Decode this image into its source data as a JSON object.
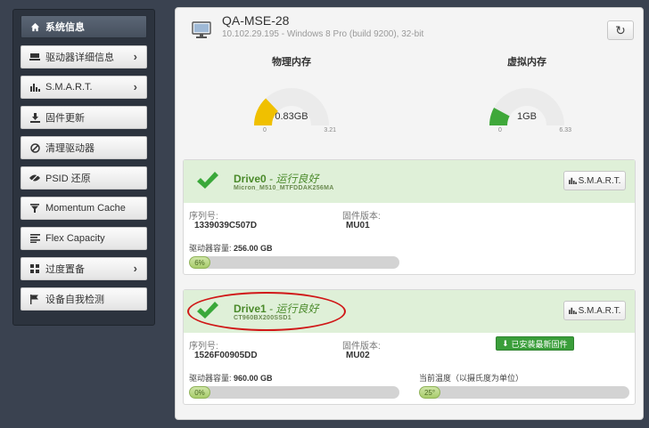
{
  "sidebar": {
    "items": [
      {
        "label": "系统信息",
        "icon": "home-icon",
        "active": true,
        "chevron": false
      },
      {
        "label": "驱动器详细信息",
        "icon": "drive-icon",
        "active": false,
        "chevron": true
      },
      {
        "label": "S.M.A.R.T.",
        "icon": "bar-chart-icon",
        "active": false,
        "chevron": true
      },
      {
        "label": "固件更新",
        "icon": "download-icon",
        "active": false,
        "chevron": false
      },
      {
        "label": "清理驱动器",
        "icon": "no-entry-icon",
        "active": false,
        "chevron": false
      },
      {
        "label": "PSID 还原",
        "icon": "psid-icon",
        "active": false,
        "chevron": false
      },
      {
        "label": "Momentum Cache",
        "icon": "filter-icon",
        "active": false,
        "chevron": false
      },
      {
        "label": "Flex Capacity",
        "icon": "list-icon",
        "active": false,
        "chevron": false
      },
      {
        "label": "过度置备",
        "icon": "grid-icon",
        "active": false,
        "chevron": true
      },
      {
        "label": "设备自我检测",
        "icon": "flag-icon",
        "active": false,
        "chevron": false
      }
    ],
    "chevron_glyph": "›"
  },
  "host": {
    "name": "QA-MSE-28",
    "subtitle": "10.102.29.195 - Windows 8 Pro (build 9200), 32-bit",
    "icon": "monitor-icon",
    "refresh_glyph": "↻"
  },
  "gauges": {
    "physical": {
      "title": "物理内存",
      "value_label": "0.83GB",
      "min_label": "0",
      "max_label": "3.21",
      "used": 0.83,
      "max": 3.21,
      "color": "#f0c000"
    },
    "virtual": {
      "title": "虚拟内存",
      "value_label": "1GB",
      "min_label": "0",
      "max_label": "6.33",
      "used": 1,
      "max": 6.33,
      "color": "#3fa83a"
    }
  },
  "drives": [
    {
      "name": "Drive0",
      "status": " - 运行良好",
      "model": "Micron_M510_MTFDDAK256MA",
      "smart_label": "S.M.A.R.T.",
      "serial_label": "序列号:",
      "serial": "1339039C507D",
      "fw_label": "固件版本:",
      "fw": "MU01",
      "capacity_label": "驱动器容量:",
      "capacity": "256.00 GB",
      "usage_label": "6%",
      "usage": 0.06
    },
    {
      "name": "Drive1",
      "status": " - 运行良好",
      "model": "CT960BX200SSD1",
      "smart_label": "S.M.A.R.T.",
      "serial_label": "序列号:",
      "serial": "1526F00905DD",
      "fw_label": "固件版本:",
      "fw": "MU02",
      "fw_button": "已安装最新固件",
      "capacity_label": "驱动器容量:",
      "capacity": "960.00 GB",
      "usage_label": "0%",
      "usage": 0.0,
      "temp_label": "当前温度（以摄氏度为单位）",
      "temp_value_label": "25°",
      "temp_fraction": 0.25
    }
  ],
  "colors": {
    "healthy_bg": "#dff0d8",
    "healthy_text": "#4a8a2a",
    "check": "#3aa83a",
    "annotation": "#d01818"
  }
}
